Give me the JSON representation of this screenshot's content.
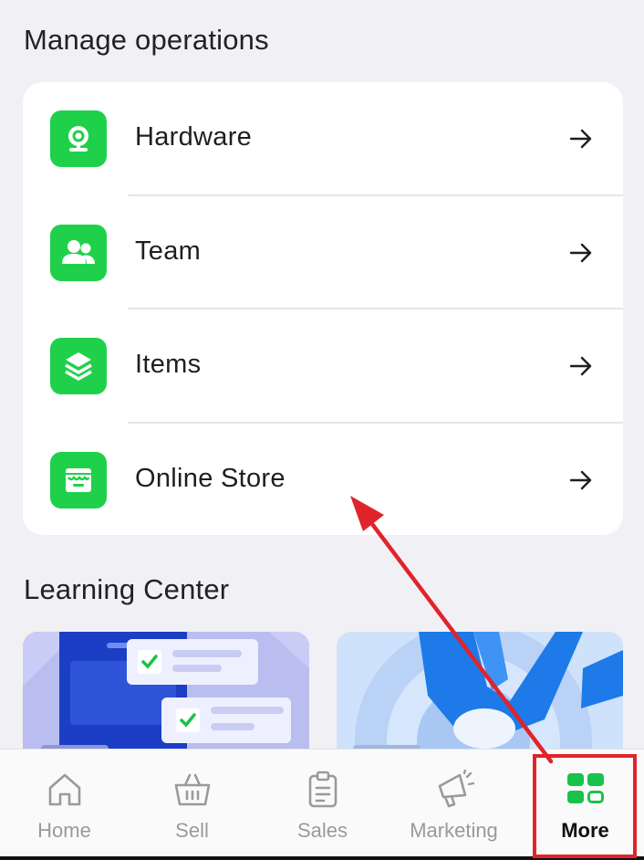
{
  "sections": {
    "operations_title": "Manage operations",
    "learning_title": "Learning Center"
  },
  "operations": [
    {
      "label": "Hardware",
      "icon": "webcam-icon"
    },
    {
      "label": "Team",
      "icon": "users-icon"
    },
    {
      "label": "Items",
      "icon": "layers-icon"
    },
    {
      "label": "Online Store",
      "icon": "storefront-icon"
    }
  ],
  "nav": {
    "items": [
      {
        "label": "Home",
        "icon": "home-icon",
        "active": false
      },
      {
        "label": "Sell",
        "icon": "basket-icon",
        "active": false
      },
      {
        "label": "Sales",
        "icon": "clipboard-icon",
        "active": false
      },
      {
        "label": "Marketing",
        "icon": "megaphone-icon",
        "active": false
      },
      {
        "label": "More",
        "icon": "grid-icon",
        "active": true
      }
    ]
  },
  "colors": {
    "accent": "#1fd14a",
    "annotation": "#e0242b",
    "background": "#f1f1f5"
  }
}
